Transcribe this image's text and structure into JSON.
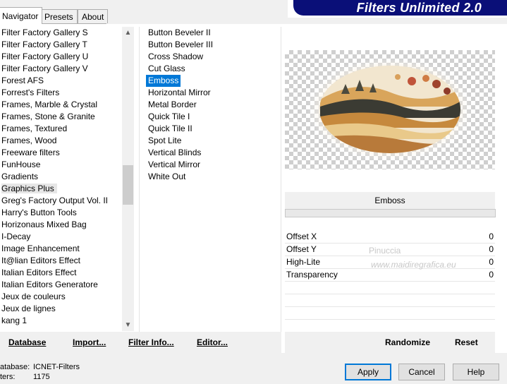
{
  "tabs": [
    "Navigator",
    "Presets",
    "About"
  ],
  "banner_title": "Filters Unlimited 2.0",
  "categories": [
    "Filter Factory Gallery S",
    "Filter Factory Gallery T",
    "Filter Factory Gallery U",
    "Filter Factory Gallery V",
    "Forest AFS",
    "Forrest's Filters",
    "Frames, Marble & Crystal",
    "Frames, Stone & Granite",
    "Frames, Textured",
    "Frames, Wood",
    "Freeware filters",
    "FunHouse",
    "Gradients",
    "Graphics Plus",
    "Greg's Factory Output Vol. II",
    "Harry's Button Tools",
    "Horizonaus Mixed Bag",
    "I-Decay",
    "Image Enhancement",
    "It@lian Editors Effect",
    "Italian Editors Effect",
    "Italian Editors Generatore",
    "Jeux de couleurs",
    "Jeux de lignes",
    "kang 1"
  ],
  "selected_category": "Graphics Plus",
  "filters": [
    "Button Beveler II",
    "Button Beveler III",
    "Cross Shadow",
    "Cut Glass",
    "Emboss",
    "Horizontal Mirror",
    "Metal Border",
    "Quick Tile I",
    "Quick Tile II",
    "Spot Lite",
    "Vertical Blinds",
    "Vertical Mirror",
    "White Out"
  ],
  "selected_filter": "Emboss",
  "filter_title": "Emboss",
  "params": [
    {
      "label": "Offset X",
      "value": "0"
    },
    {
      "label": "Offset Y",
      "value": "0"
    },
    {
      "label": "High-Lite",
      "value": "0"
    },
    {
      "label": "Transparency",
      "value": "0"
    }
  ],
  "watermark": {
    "line1": "Pinuccia",
    "line2": "www.maidiregrafica.eu"
  },
  "buttons": {
    "database": "Database",
    "import": "Import...",
    "filter_info": "Filter Info...",
    "editor": "Editor...",
    "randomize": "Randomize",
    "reset": "Reset",
    "apply": "Apply",
    "cancel": "Cancel",
    "help": "Help"
  },
  "footer": {
    "database_label": "atabase:",
    "database_value": "ICNET-Filters",
    "filters_label": "ters:",
    "filters_value": "1175"
  },
  "colors": {
    "selection": "#0078d7",
    "banner": "#0a0f78"
  }
}
